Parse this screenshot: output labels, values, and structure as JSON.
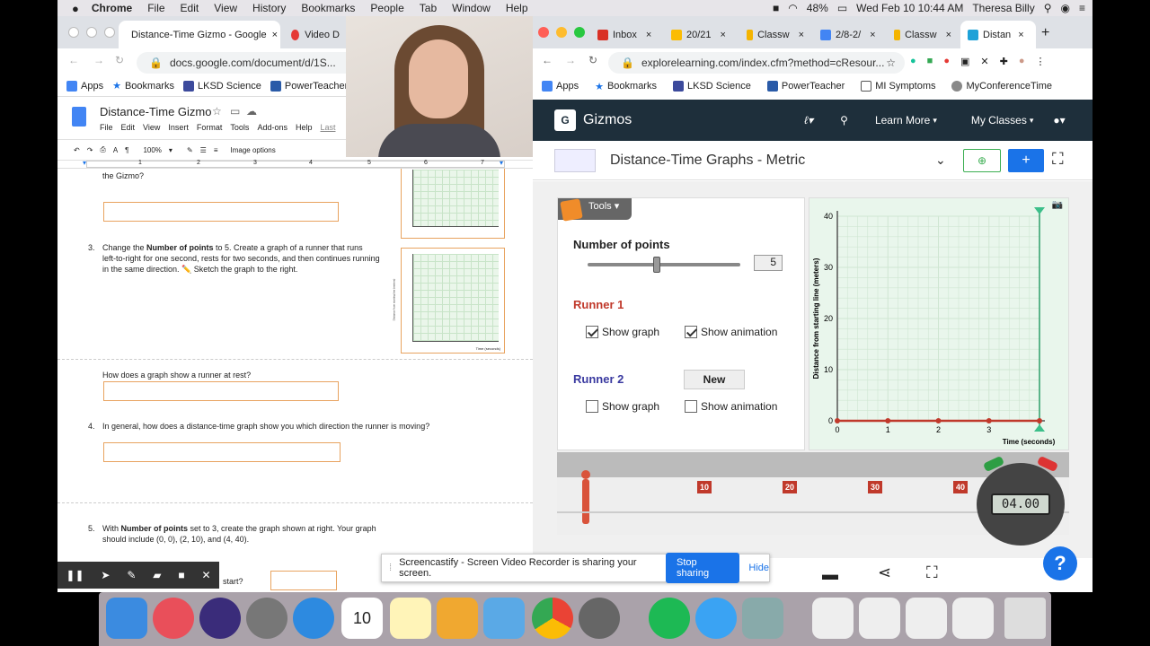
{
  "menubar": {
    "items": [
      "Chrome",
      "File",
      "Edit",
      "View",
      "History",
      "Bookmarks",
      "People",
      "Tab",
      "Window",
      "Help"
    ],
    "battery": "48%",
    "datetime": "Wed Feb 10  10:44 AM",
    "user": "Theresa Billy"
  },
  "left_browser": {
    "tabs": [
      {
        "label": "Distance-Time Gizmo - Google"
      },
      {
        "label": "Video D"
      }
    ],
    "url": "docs.google.com/document/d/1S...",
    "bookmarks": [
      "Apps",
      "Bookmarks",
      "LKSD Science",
      "PowerTeacher"
    ],
    "doc_title": "Distance-Time Gizmo",
    "doc_menu": [
      "File",
      "Edit",
      "View",
      "Insert",
      "Format",
      "Tools",
      "Add-ons",
      "Help",
      "Last"
    ],
    "zoom": "100%",
    "image_options": "Image options",
    "ruler": [
      "1",
      "2",
      "3",
      "4",
      "5",
      "6",
      "7"
    ],
    "q_prev": "the Gizmo?",
    "q3_num": "3.",
    "q3_line1_a": "Change the ",
    "q3_line1_b": "Number of points",
    "q3_line1_c": " to 5. Create a graph of a runner that runs",
    "q3_line2": "left-to-right for one second, rests for two seconds, and then continues running",
    "q3_line3": "in the same direction. ✏️ Sketch the graph to the right.",
    "rest_q": "How does a graph show a runner at rest?",
    "q4_num": "4.",
    "q4": "In general, how does a distance-time graph show you which direction the runner is moving?",
    "q5_num": "5.",
    "q5_line1_a": "With ",
    "q5_line1_b": "Number of points",
    "q5_line1_c": " set to 3, create the graph shown at right. Your graph",
    "q5_line2": "should include (0, 0), (2, 10), and (4, 40).",
    "q5_start": "start?",
    "mini_ylabel": "Distance from starting line (meters)",
    "mini_xlabel": "Time (seconds)"
  },
  "right_browser": {
    "tabs": [
      "Inbox",
      "20/21",
      "Classw",
      "2/8-2/",
      "Classw",
      "Distan"
    ],
    "url": "explorelearning.com/index.cfm?method=cResour...",
    "bookmarks": [
      "Apps",
      "Bookmarks",
      "LKSD Science",
      "PowerTeacher",
      "MI Symptoms",
      "MyConferenceTime"
    ],
    "brand": "Gizmos",
    "nav": [
      "Learn More",
      "My Classes"
    ],
    "gizmo_title": "Distance-Time Graphs - Metric",
    "tools": "Tools",
    "num_points_label": "Number of points",
    "num_points_value": "5",
    "num_points_fraction": 0.45,
    "runner1": "Runner 1",
    "runner2": "Runner 2",
    "show_graph": "Show graph",
    "show_animation": "Show animation",
    "new_button": "New",
    "r1_graph": true,
    "r1_anim": true,
    "r2_graph": false,
    "r2_anim": false,
    "track_marks": [
      "10",
      "20",
      "30",
      "40"
    ],
    "timer": "04.00",
    "colors": {
      "runner1": "#c0392b",
      "runner2": "#3a3aa0",
      "accent": "#1a73e8",
      "header": "#1e2f3b"
    }
  },
  "chart_data": {
    "type": "line",
    "xlabel": "Time (seconds)",
    "ylabel": "Distance from starting line (meters)",
    "xlim": [
      0,
      4
    ],
    "ylim": [
      0,
      40
    ],
    "xticks": [
      0,
      1,
      2,
      3
    ],
    "yticks": [
      0,
      10,
      20,
      30,
      40
    ],
    "series": [
      {
        "x": [
          0,
          1,
          2,
          3,
          4
        ],
        "y": [
          0,
          0,
          0,
          0,
          0
        ],
        "color": "#c0392b"
      }
    ],
    "grid": true
  },
  "screencastify": {
    "message": "Screencastify - Screen Video Recorder is sharing your screen.",
    "stop": "Stop sharing",
    "hide": "Hide"
  },
  "icons": [
    "apple-icon",
    "wifi-icon",
    "search-icon",
    "pause-icon",
    "pointer-icon",
    "pen-icon",
    "highlighter-icon",
    "camera-icon",
    "close-icon",
    "help-icon",
    "share-icon",
    "chat-icon",
    "fullscreen-icon"
  ]
}
